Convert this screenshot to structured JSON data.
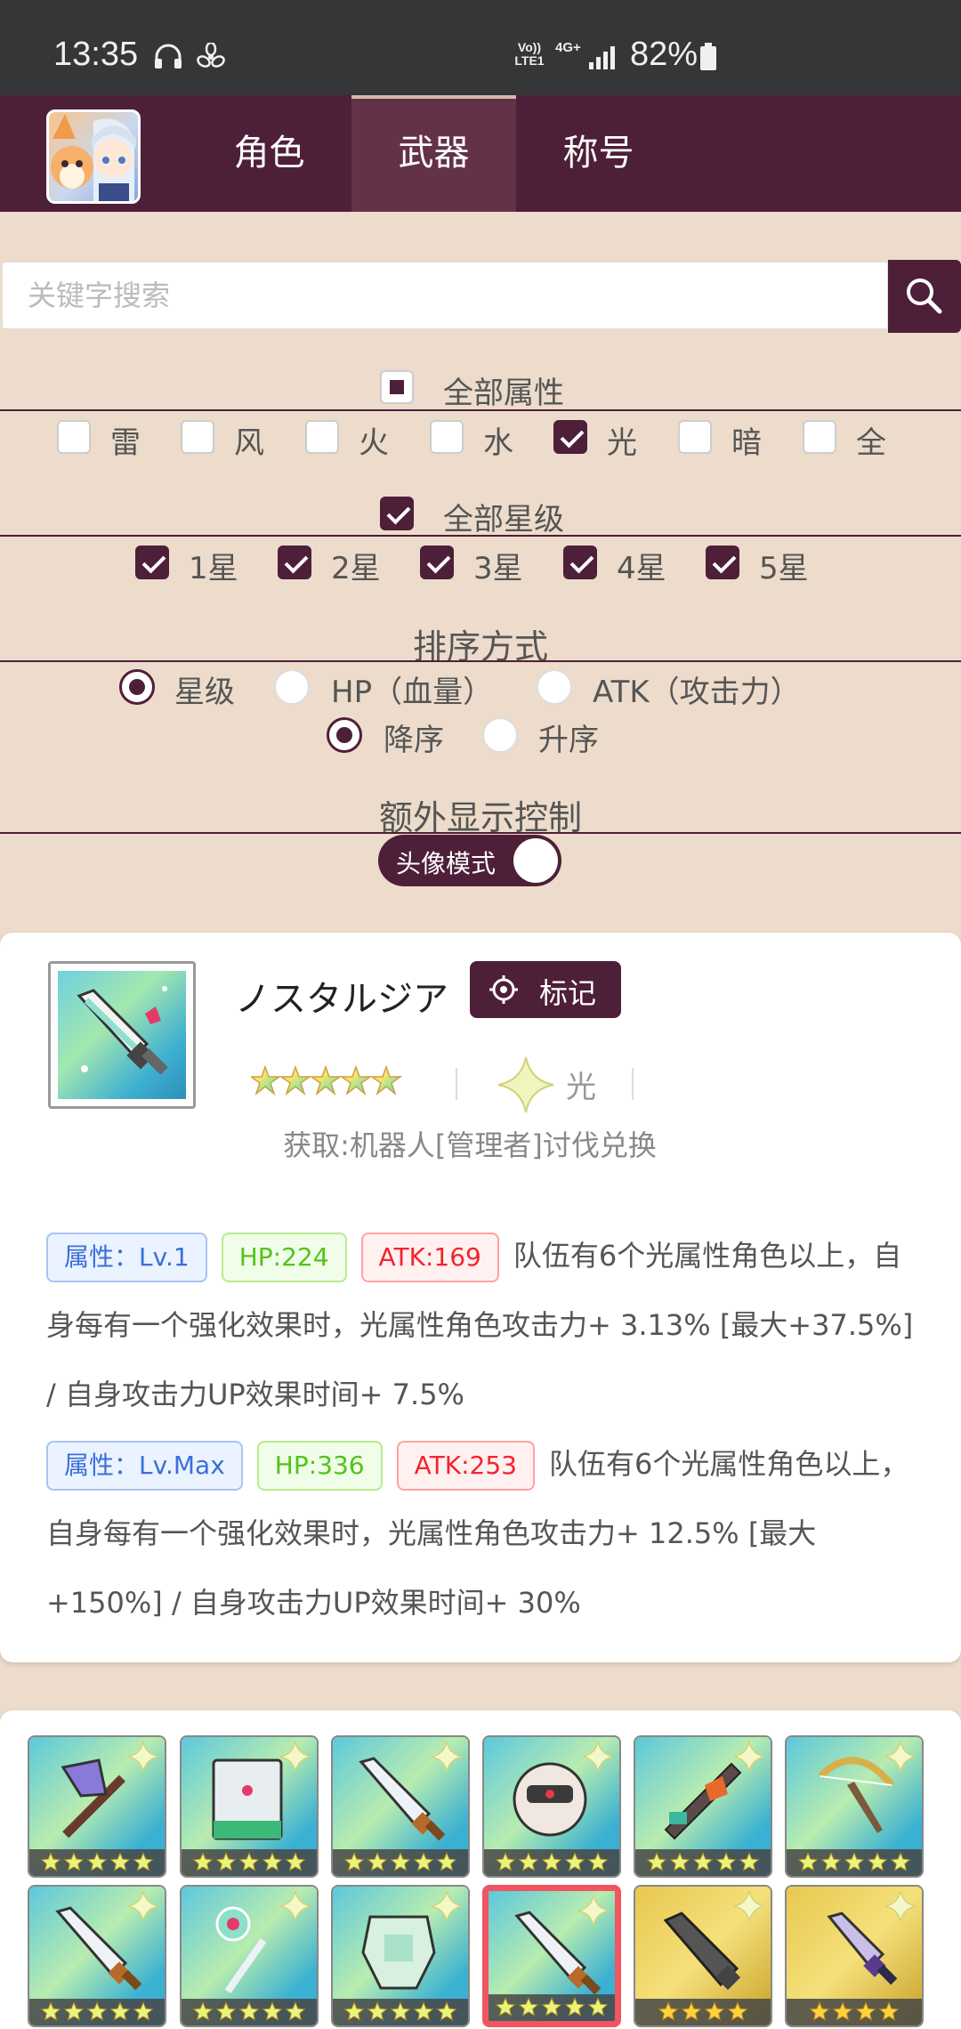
{
  "status_bar": {
    "time": "13:35",
    "volte": "Vo)) LTE1",
    "network": "4G+",
    "battery": "82%"
  },
  "nav": {
    "tabs": [
      "角色",
      "武器",
      "称号"
    ],
    "active_tab": "武器"
  },
  "search": {
    "placeholder": "关键字搜索",
    "value": ""
  },
  "filters": {
    "all_attributes_label": "全部属性",
    "attributes": [
      {
        "label": "雷",
        "checked": false
      },
      {
        "label": "风",
        "checked": false
      },
      {
        "label": "火",
        "checked": false
      },
      {
        "label": "水",
        "checked": false
      },
      {
        "label": "光",
        "checked": true
      },
      {
        "label": "暗",
        "checked": false
      },
      {
        "label": "全",
        "checked": false
      }
    ],
    "all_stars_label": "全部星级",
    "stars": [
      {
        "label": "1星",
        "checked": true
      },
      {
        "label": "2星",
        "checked": true
      },
      {
        "label": "3星",
        "checked": true
      },
      {
        "label": "4星",
        "checked": true
      },
      {
        "label": "5星",
        "checked": true
      }
    ]
  },
  "sort": {
    "title": "排序方式",
    "by_options": [
      "星级",
      "HP（血量）",
      "ATK（攻击力）"
    ],
    "by_selected": "星级",
    "order_options": [
      "降序",
      "升序"
    ],
    "order_selected": "降序"
  },
  "extra": {
    "title": "额外显示控制",
    "avatar_mode_label": "头像模式",
    "avatar_mode_on": true
  },
  "detail": {
    "name": "ノスタルジア",
    "mark_label": "标记",
    "stars": 5,
    "element": "光",
    "obtain": "获取:机器人[管理者]讨伐兑换",
    "levels": [
      {
        "level_tag": "属性：Lv.1",
        "hp_tag": "HP:224",
        "atk_tag": "ATK:169",
        "text": "队伍有6个光属性角色以上，自身每有一个强化效果时，光属性角色攻击力+ 3.13% [最大+37.5%] / 自身攻击力UP效果时间+ 7.5%"
      },
      {
        "level_tag": "属性：Lv.Max",
        "hp_tag": "HP:336",
        "atk_tag": "ATK:253",
        "text": "队伍有6个光属性角色以上，自身每有一个强化效果时，光属性角色攻击力+ 12.5% [最大+150%] / 自身攻击力UP效果时间+ 30%"
      }
    ]
  },
  "grid": {
    "items": [
      {
        "icon": "axe-icon",
        "stars": 5,
        "selected": false,
        "tint": "#5cc8dc"
      },
      {
        "icon": "book-icon",
        "stars": 5,
        "selected": false,
        "tint": "#5cc8dc"
      },
      {
        "icon": "sword-icon",
        "stars": 5,
        "selected": false,
        "tint": "#5cc8dc"
      },
      {
        "icon": "robot-icon",
        "stars": 5,
        "selected": false,
        "tint": "#5cc8dc"
      },
      {
        "icon": "gun-icon",
        "stars": 5,
        "selected": false,
        "tint": "#5cc8dc"
      },
      {
        "icon": "bow-icon",
        "stars": 5,
        "selected": false,
        "tint": "#5cc8dc"
      },
      {
        "icon": "sword-icon",
        "stars": 5,
        "selected": false,
        "tint": "#5cc8dc"
      },
      {
        "icon": "staff-icon",
        "stars": 5,
        "selected": false,
        "tint": "#5cc8dc"
      },
      {
        "icon": "armor-icon",
        "stars": 5,
        "selected": false,
        "tint": "#5cc8dc"
      },
      {
        "icon": "sword-icon",
        "stars": 5,
        "selected": true,
        "tint": "#5cc8dc"
      },
      {
        "icon": "greatsword-icon",
        "stars": 4,
        "selected": false,
        "tint": "#e8c850"
      },
      {
        "icon": "dagger-icon",
        "stars": 4,
        "selected": false,
        "tint": "#e8c850"
      }
    ]
  },
  "colors": {
    "brand": "#4e1f38",
    "background": "#eddccb",
    "selected_border": "#f05560"
  }
}
